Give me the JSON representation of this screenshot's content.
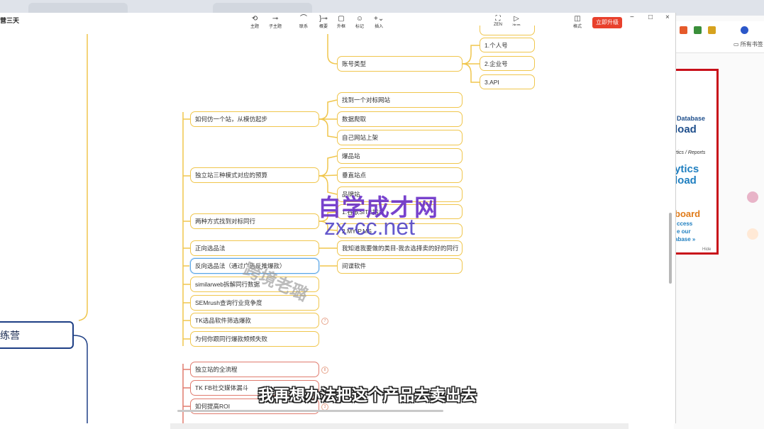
{
  "app": {
    "title": "营三天",
    "toolbar": [
      {
        "icon": "theme-icon",
        "glyph": "⟲",
        "label": "主题"
      },
      {
        "icon": "sub-topic-icon",
        "glyph": "⊸",
        "label": "子主题"
      },
      {
        "icon": "link-icon",
        "glyph": "⌒",
        "label": "联系"
      },
      {
        "icon": "summary-icon",
        "glyph": "}⊸",
        "label": "概要"
      },
      {
        "icon": "frame-icon",
        "glyph": "▢",
        "label": "外框"
      },
      {
        "icon": "mark-icon",
        "glyph": "☺",
        "label": "标记"
      },
      {
        "icon": "insert-icon",
        "glyph": "+⌄",
        "label": "插入"
      },
      {
        "icon": "zen-icon",
        "glyph": "⛶",
        "label": "ZEN"
      },
      {
        "icon": "present-icon",
        "glyph": "▷",
        "label": "演示"
      },
      {
        "icon": "format-icon",
        "glyph": "◫",
        "label": "格式"
      }
    ],
    "upgrade_label": "立即升级",
    "window_controls": {
      "minimize": "−",
      "maximize": "□",
      "close": "×"
    }
  },
  "mindmap": {
    "center": "练营",
    "nodes": {
      "account_type": "账号类型",
      "personal": "1.个人号",
      "enterprise": "2.企业号",
      "api": "3.API",
      "clone_site": "如何仿一个站，从模仿起步",
      "find_benchmark_site": "找到一个对标网站",
      "data_scrape": "数据爬取",
      "own_site_launch": "自己网站上架",
      "three_modes": "独立站三种模式对应的预算",
      "hot_site": "爆品站",
      "vertical_site": "垂直站点",
      "product_site": "品牌站",
      "two_ways": "两种方式找到对标同行",
      "google_site": "1.谷歌SITE指令",
      "myip": "2.MYIP.MS",
      "forward_selection": "正向选品法",
      "know_category": "我知道我要做的类目-我去选择卖的好的同行",
      "reverse_selection": "反向选品法（通过广告反推爆款）",
      "spy_software": "间谍软件",
      "similarweb": "similarweb拆解同行数据",
      "semrush": "SEMrush查询行业竞争度",
      "tk_tool": "TK选品软件筛选爆款",
      "why_fail": "为何你跟同行爆款频频失败",
      "full_process": "独立站的全流程",
      "tk_fb": "TK FB社交媒体漏斗",
      "roi": "如何提高ROI"
    },
    "badges": {
      "tk_tool": "7",
      "full_process": "8",
      "roi": "3"
    }
  },
  "overlay": {
    "watermark_brand": "自学成才网",
    "watermark_url": "zx-cc.net",
    "watermark_author": "跨境老璐",
    "subtitle": "我再想办法把这个产品去卖出去"
  },
  "browser": {
    "bookmarks_label": "所有书签"
  },
  "ad": {
    "line1": "Database",
    "line2": "load",
    "line3": "ytics / Reports",
    "line4": "ytics",
    "line5": "load",
    "line6": "board",
    "line7": "ccess",
    "line8": "e our",
    "line9": "abase »",
    "hide": "Hide"
  },
  "colors": {
    "node_border": "#f0c64d",
    "red_node_border": "#e07b6e",
    "center_border": "#1e3f85",
    "upgrade_button": "#e8402c",
    "watermark": "#6a2ec8"
  }
}
